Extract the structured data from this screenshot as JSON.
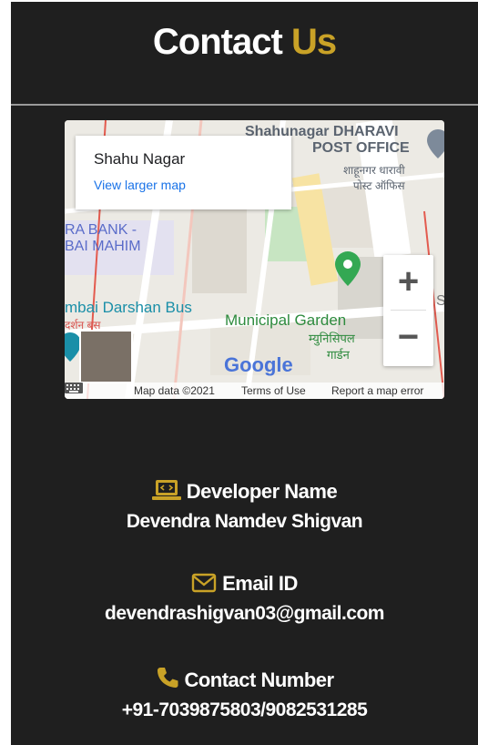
{
  "header": {
    "title_part1": "Contact",
    "title_part2": "Us"
  },
  "map": {
    "info_card": {
      "place_name": "Shahu Nagar",
      "link_text": "View larger map"
    },
    "labels": {
      "post_office_line1": "Shahunagar DHARAVI",
      "post_office_line2": "POST OFFICE",
      "post_office_hindi_line1": "शाहूनगर धारावी",
      "post_office_hindi_line2": "पोस्ट ऑफिस",
      "bank_line1": "RA BANK -",
      "bank_line2": "BAI MAHIM",
      "bus_line1": "mbai Darshan Bus",
      "bus_line2": "दर्शन बस",
      "garden_line1": "Municipal Garden",
      "garden_hindi_line1": "म्युनिसिपल",
      "garden_hindi_line2": "गार्डन",
      "edge_label": "S"
    },
    "google_logo": "Google",
    "zoom_in": "+",
    "zoom_out": "−",
    "attribution": {
      "map_data": "Map data ©2021",
      "terms": "Terms of Use",
      "report": "Report a map error"
    }
  },
  "contact": {
    "developer": {
      "icon": "laptop-code-icon",
      "label": "Developer Name",
      "value": "Devendra Namdev Shigvan"
    },
    "email": {
      "icon": "envelope-icon",
      "label": "Email ID",
      "value": "devendrashigvan03@gmail.com"
    },
    "phone": {
      "icon": "phone-icon",
      "label": "Contact Number",
      "value": "+91-7039875803/9082531285"
    }
  },
  "colors": {
    "background": "#1f1f1f",
    "accent": "#c9a227",
    "text": "#ffffff",
    "divider": "#9a9a9a"
  }
}
